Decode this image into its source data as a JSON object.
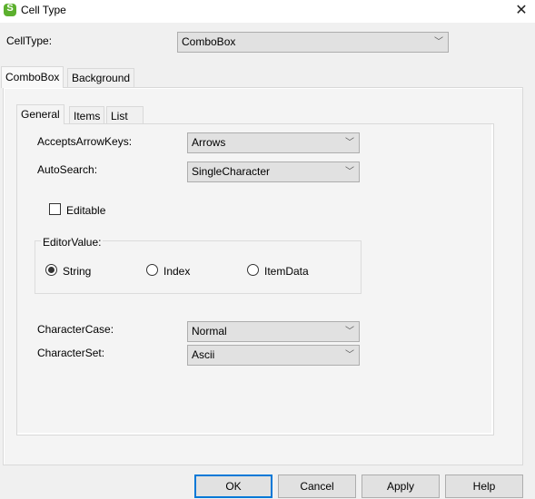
{
  "window": {
    "title": "Cell Type",
    "icon": "app-logo-icon",
    "close_icon": "close-icon"
  },
  "celltype": {
    "label": "CellType:",
    "value": "ComboBox"
  },
  "outer_tabs": [
    {
      "label": "ComboBox",
      "active": true
    },
    {
      "label": "Background",
      "active": false
    }
  ],
  "inner_tabs": [
    {
      "label": "General",
      "active": true
    },
    {
      "label": "Items",
      "active": false
    },
    {
      "label": "List",
      "active": false
    }
  ],
  "general": {
    "accepts_arrow_keys": {
      "label": "AcceptsArrowKeys:",
      "value": "Arrows"
    },
    "auto_search": {
      "label": "AutoSearch:",
      "value": "SingleCharacter"
    },
    "editable": {
      "label": "Editable",
      "checked": false
    },
    "editor_value": {
      "legend": "EditorValue:",
      "options": [
        {
          "label": "String",
          "checked": true
        },
        {
          "label": "Index",
          "checked": false
        },
        {
          "label": "ItemData",
          "checked": false
        }
      ]
    },
    "character_case": {
      "label": "CharacterCase:",
      "value": "Normal"
    },
    "character_set": {
      "label": "CharacterSet:",
      "value": "Ascii"
    }
  },
  "buttons": {
    "ok": "OK",
    "cancel": "Cancel",
    "apply": "Apply",
    "help": "Help"
  },
  "glyphs": {
    "chevron": "﹀",
    "close": "✕"
  },
  "colors": {
    "focus_accent": "#0078d7",
    "logo_green": "#5cb02e"
  }
}
